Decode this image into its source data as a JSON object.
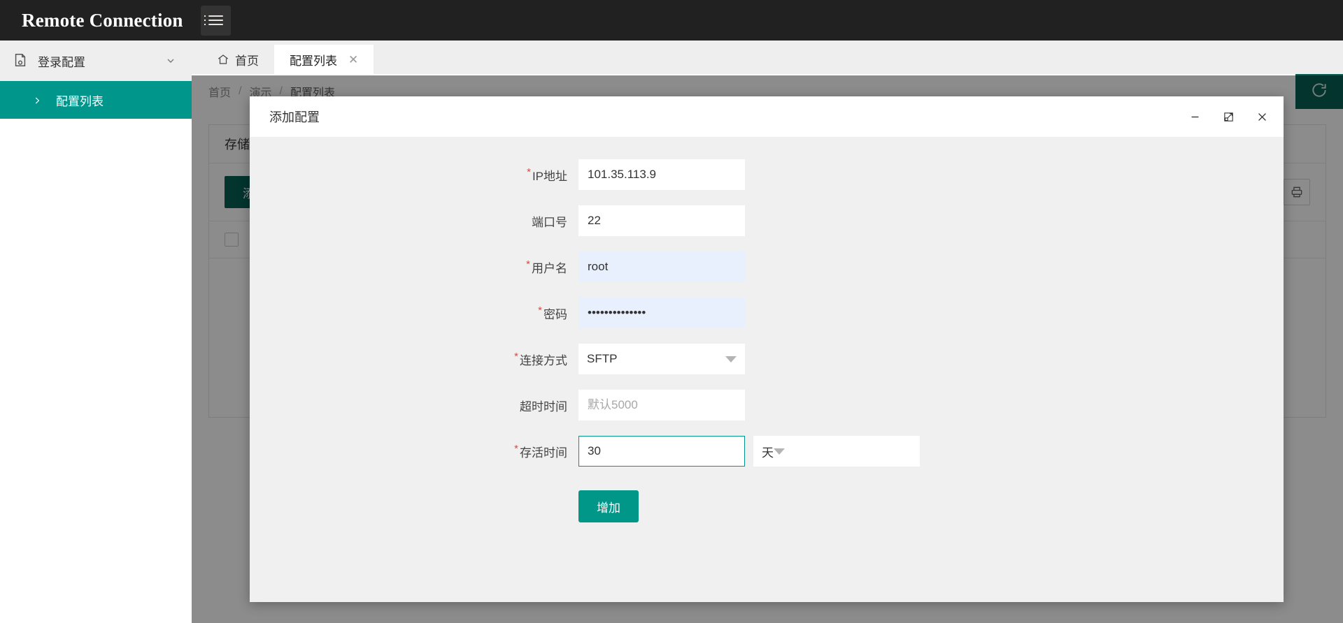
{
  "app": {
    "brand": "Remote Connection",
    "menu_icon": "hamburger-icon"
  },
  "sidebar": {
    "group": {
      "label": "登录配置",
      "icon": "document-config-icon",
      "chevron": "chevron-down-icon"
    },
    "items": [
      {
        "label": "配置列表",
        "icon": "chevron-right-icon",
        "active": true
      }
    ]
  },
  "tabs": [
    {
      "label": "首页",
      "icon": "home-icon",
      "active": false,
      "closable": false
    },
    {
      "label": "配置列表",
      "icon": "",
      "active": true,
      "closable": true,
      "close_glyph": "✕"
    }
  ],
  "breadcrumb": {
    "items": [
      "首页",
      "演示",
      "配置列表"
    ],
    "separator": "/"
  },
  "toolbar": {
    "refresh_icon": "refresh-icon"
  },
  "page": {
    "card_title": "存储方案",
    "add_button": "添加",
    "print_icon": "printer-icon",
    "settings_icon": "columns-icon"
  },
  "modal": {
    "title": "添加配置",
    "window_controls": {
      "minimize": "minimize-icon",
      "maximize": "maximize-icon",
      "close": "close-icon"
    },
    "fields": [
      {
        "label": "IP地址",
        "required": true,
        "value": "101.35.113.9",
        "placeholder": "",
        "type": "text",
        "state": "normal"
      },
      {
        "label": "端口号",
        "required": false,
        "value": "22",
        "placeholder": "",
        "type": "text",
        "state": "normal"
      },
      {
        "label": "用户名",
        "required": true,
        "value": "root",
        "placeholder": "",
        "type": "text",
        "state": "autofill"
      },
      {
        "label": "密码",
        "required": true,
        "value": "••••••••••••••",
        "placeholder": "",
        "type": "password",
        "state": "autofill"
      },
      {
        "label": "连接方式",
        "required": true,
        "value": "SFTP",
        "placeholder": "",
        "type": "select",
        "state": "normal"
      },
      {
        "label": "超时时间",
        "required": false,
        "value": "",
        "placeholder": "默认5000",
        "type": "text",
        "state": "normal"
      },
      {
        "label": "存活时间",
        "required": true,
        "value": "30",
        "placeholder": "",
        "type": "text-with-unit",
        "state": "focused",
        "unit_value": "天"
      }
    ],
    "submit_label": "增加"
  },
  "colors": {
    "topbar": "#212121",
    "accent_teal": "#00968c",
    "dark_teal": "#065f54",
    "submit_teal": "#009688",
    "required_red": "#f04134",
    "autofill_blue": "#e8f0fe"
  }
}
